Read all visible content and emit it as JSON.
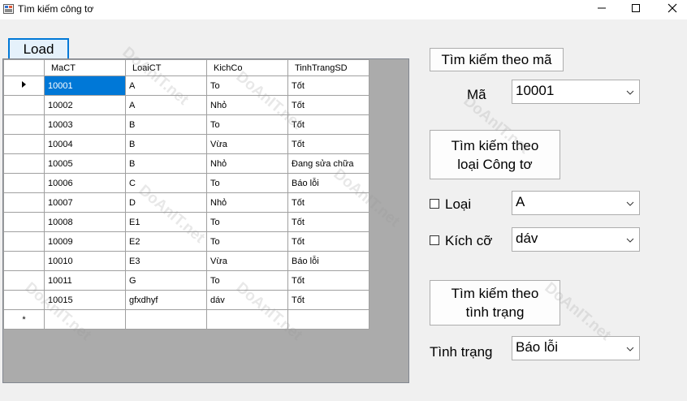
{
  "window": {
    "title": "Tìm kiếm công tơ"
  },
  "toolbar": {
    "load_label": "Load"
  },
  "grid": {
    "columns": [
      "MaCT",
      "LoaiCT",
      "KichCo",
      "TinhTrangSD"
    ],
    "rows": [
      [
        "10001",
        "A",
        "To",
        "Tốt"
      ],
      [
        "10002",
        "A",
        "Nhỏ",
        "Tốt"
      ],
      [
        "10003",
        "B",
        "To",
        "Tốt"
      ],
      [
        "10004",
        "B",
        "Vừa",
        "Tốt"
      ],
      [
        "10005",
        "B",
        "Nhỏ",
        "Đang sửa chữa"
      ],
      [
        "10006",
        "C",
        "To",
        "Báo lỗi"
      ],
      [
        "10007",
        "D",
        "Nhỏ",
        "Tốt"
      ],
      [
        "10008",
        "E1",
        "To",
        "Tốt"
      ],
      [
        "10009",
        "E2",
        "To",
        "Tốt"
      ],
      [
        "10010",
        "E3",
        "Vừa",
        "Báo lỗi"
      ],
      [
        "10011",
        "G",
        "To",
        "Tốt"
      ],
      [
        "10015",
        "gfxdhyf",
        "dáv",
        "Tốt"
      ]
    ],
    "current_row_marker": "▶",
    "new_row_marker": "*"
  },
  "search_by_code": {
    "button_label": "Tìm kiếm theo mã",
    "field_label": "Mã",
    "value": "10001"
  },
  "search_by_type": {
    "button_label": "Tìm kiếm theo\nloại Công tơ",
    "type_label": "Loại",
    "type_value": "A",
    "size_label": "Kích cỡ",
    "size_value": "dáv"
  },
  "search_by_status": {
    "button_label": "Tìm kiếm theo\ntình trạng",
    "field_label": "Tình trạng",
    "value": "Báo lỗi"
  },
  "watermark": {
    "text": "DoAnIT.net"
  },
  "colors": {
    "selection": "#0078d7",
    "grid_background": "#ababab",
    "form_background": "#f0f0f0"
  }
}
